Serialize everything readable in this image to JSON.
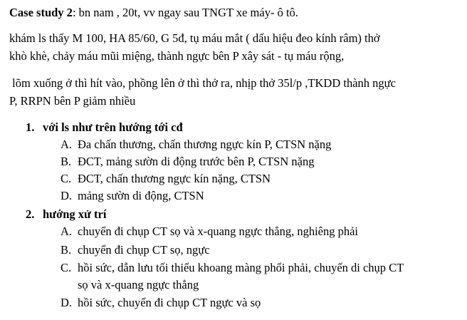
{
  "case": {
    "label": "Case study 2",
    "intro": ": bn nam , 20t, vv ngay sau TNGT xe máy- ô tô.",
    "exam_lines": [
      "khám ls thấy M 100, HA 85/60, G 5đ, tụ máu mắt ( dấu hiệu đeo kính râm) thở",
      "khò khè, chảy máu mũi miệng, thành ngực bên P xây sát - tụ máu rộng,",
      " lõm xuống ở thì hít vào, phồng lên ở thì thở ra, nhịp thở 35l/p ,TKDD thành ngực",
      "P, RRPN bên P giảm nhiều"
    ]
  },
  "questions": [
    {
      "number": "1.",
      "text": "với ls như trên hướng tới cđ",
      "options": [
        {
          "letter": "A.",
          "text": "Đa chấn thương, chấn thương ngực kín P, CTSN nặng"
        },
        {
          "letter": "B.",
          "text": "ĐCT, mảng sườn di động trước bên P, CTSN nặng"
        },
        {
          "letter": "C.",
          "text": "ĐCT, chấn thương ngực kín nặng, CTSN"
        },
        {
          "letter": "D.",
          "text": "mảng sườn di động, CTSN"
        }
      ]
    },
    {
      "number": "2.",
      "text": "hướng xử trí",
      "options": [
        {
          "letter": "A.",
          "text": "chuyển đi chụp CT sọ và x-quang ngực thẳng, nghiêng phải"
        },
        {
          "letter": "B.",
          "text": "chuyển đi chụp CT sọ, ngực"
        },
        {
          "letter": "C.",
          "text": "hồi sức, dẫn lưu tối thiểu khoang màng phổi phải, chuyển di chụp CT",
          "continuation": "sọ và x-quang ngực thẳng"
        },
        {
          "letter": "D.",
          "text": "hồi sức, chuyển đi chụp CT ngực và sọ"
        }
      ]
    }
  ]
}
